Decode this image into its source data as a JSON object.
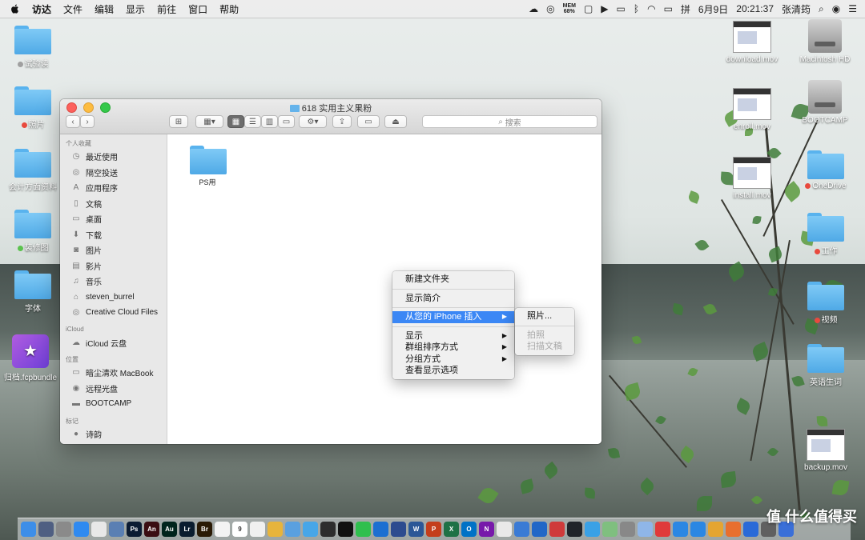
{
  "menubar": {
    "app": "访达",
    "items": [
      "文件",
      "编辑",
      "显示",
      "前往",
      "窗口",
      "帮助"
    ],
    "status_mem": "MEM\n68%",
    "date": "6月9日",
    "time": "20:21:37",
    "user": "张清筠"
  },
  "desktop_left": [
    {
      "label": "试验读",
      "tag": "#a0a0a0"
    },
    {
      "label": "照片",
      "tag": "#e84a3e"
    },
    {
      "label": "会计方面资料",
      "tag": ""
    },
    {
      "label": "装修图",
      "tag": "#5bc24e"
    },
    {
      "label": "字体",
      "tag": ""
    },
    {
      "label": "归档.fcpbundle",
      "tag": ""
    }
  ],
  "desktop_right": [
    {
      "label": "download.mov",
      "kind": "thumb"
    },
    {
      "label": "Macintosh HD",
      "kind": "disk"
    },
    {
      "label": "enroll.mov",
      "kind": "thumb"
    },
    {
      "label": "BOOTCAMP",
      "kind": "disk"
    },
    {
      "label": "OneDrive",
      "kind": "folder",
      "tag": "#e84a3e"
    },
    {
      "label": "install.mov",
      "kind": "thumb"
    },
    {
      "label": "工作",
      "kind": "folder",
      "tag": "#e84a3e"
    },
    {
      "label": "视频",
      "kind": "folder",
      "tag": "#e84a3e"
    },
    {
      "label": "英语生词",
      "kind": "folder"
    },
    {
      "label": "backup.mov",
      "kind": "thumb"
    }
  ],
  "finder": {
    "title": "618 实用主义果粉",
    "search_placeholder": "搜索",
    "sidebar": {
      "favorites_header": "个人收藏",
      "favorites": [
        "最近使用",
        "隔空投送",
        "应用程序",
        "文稿",
        "桌面",
        "下载",
        "图片",
        "影片",
        "音乐",
        "steven_burrel",
        "Creative Cloud Files"
      ],
      "icloud_header": "iCloud",
      "icloud": [
        "iCloud 云盘"
      ],
      "locations_header": "位置",
      "locations": [
        "暗尘清欢 MacBook",
        "远程光盘",
        "BOOTCAMP"
      ],
      "tags_header": "标记",
      "tags": [
        "诗韵"
      ]
    },
    "files": [
      {
        "name": "PS用"
      }
    ]
  },
  "context_menu": {
    "items": [
      "新建文件夹",
      "显示简介",
      "从您的 iPhone 插入",
      "显示",
      "群组排序方式",
      "分组方式",
      "查看显示选项"
    ]
  },
  "submenu": {
    "items": [
      "照片...",
      "拍照",
      "扫描文稿"
    ]
  },
  "dock": {
    "apps": [
      {
        "label": "",
        "color": "#3d8ee8"
      },
      {
        "label": "",
        "color": "#4f5f82"
      },
      {
        "label": "",
        "color": "#8a8a8a"
      },
      {
        "label": "",
        "color": "#2f8af0"
      },
      {
        "label": "",
        "color": "#e8e8e8"
      },
      {
        "label": "",
        "color": "#5a7fb3"
      },
      {
        "label": "Ps",
        "color": "#0b1b32"
      },
      {
        "label": "An",
        "color": "#3a0d12"
      },
      {
        "label": "Au",
        "color": "#00241c"
      },
      {
        "label": "Lr",
        "color": "#0a1c2e"
      },
      {
        "label": "Br",
        "color": "#2a1a05"
      },
      {
        "label": "",
        "color": "#f3f3f3"
      },
      {
        "label": "9",
        "color": "#ffffff"
      },
      {
        "label": "",
        "color": "#f0f0f0"
      },
      {
        "label": "",
        "color": "#e7b43c"
      },
      {
        "label": "",
        "color": "#5aa0e0"
      },
      {
        "label": "",
        "color": "#47a6e8"
      },
      {
        "label": "",
        "color": "#2d2d2d"
      },
      {
        "label": "",
        "color": "#111111"
      },
      {
        "label": "",
        "color": "#2fbf4e"
      },
      {
        "label": "",
        "color": "#1c6fd1"
      },
      {
        "label": "",
        "color": "#2d4b8f"
      },
      {
        "label": "W",
        "color": "#2b5797"
      },
      {
        "label": "P",
        "color": "#c43e1c"
      },
      {
        "label": "X",
        "color": "#1e7145"
      },
      {
        "label": "O",
        "color": "#0072c6"
      },
      {
        "label": "N",
        "color": "#7719aa"
      },
      {
        "label": "",
        "color": "#e9e9e9"
      },
      {
        "label": "",
        "color": "#3a7bd5"
      },
      {
        "label": "",
        "color": "#2167c7"
      },
      {
        "label": "",
        "color": "#cf3a3a"
      },
      {
        "label": "",
        "color": "#20242a"
      },
      {
        "label": "",
        "color": "#3aa1e6"
      },
      {
        "label": "",
        "color": "#7fbf7f"
      },
      {
        "label": "",
        "color": "#888888"
      },
      {
        "label": "",
        "color": "#8fb6e8"
      },
      {
        "label": "",
        "color": "#e03a3a"
      },
      {
        "label": "",
        "color": "#2b87e3"
      },
      {
        "label": "",
        "color": "#2b87e3"
      },
      {
        "label": "",
        "color": "#e5a531"
      },
      {
        "label": "",
        "color": "#e86f2e"
      },
      {
        "label": "",
        "color": "#2a6ad8"
      },
      {
        "label": "",
        "color": "#606060"
      },
      {
        "label": "",
        "color": "#3a6fd8"
      }
    ]
  },
  "watermark": "值 什么值得买",
  "colors": {
    "accent": "#3b87f5",
    "folder": "#5fb3ee",
    "close": "#fc605c",
    "min": "#fdbc40",
    "max": "#34c84a"
  }
}
